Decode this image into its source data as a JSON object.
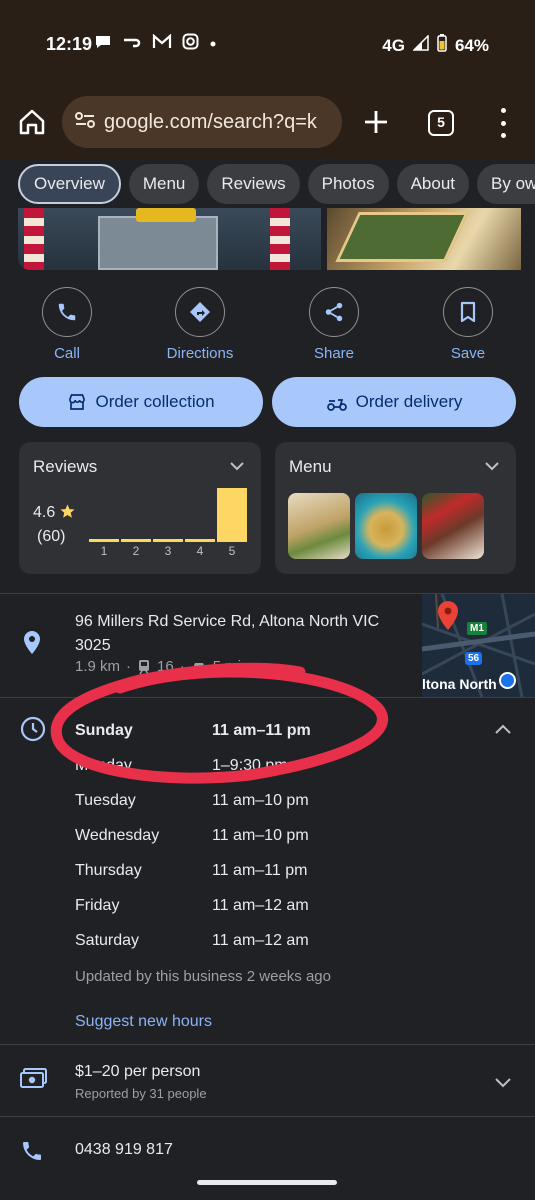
{
  "status": {
    "time": "12:19",
    "network": "4G",
    "battery": "64%"
  },
  "browser": {
    "url": "google.com/search?q=k",
    "tab_count": "5"
  },
  "nav": {
    "tabs": [
      {
        "label": "Overview"
      },
      {
        "label": "Menu"
      },
      {
        "label": "Reviews"
      },
      {
        "label": "Photos"
      },
      {
        "label": "About"
      },
      {
        "label": "By own"
      }
    ]
  },
  "actions": {
    "call": "Call",
    "directions": "Directions",
    "share": "Share",
    "save": "Save"
  },
  "order": {
    "collection": "Order collection",
    "delivery": "Order delivery"
  },
  "reviews_card": {
    "title": "Reviews",
    "rating": "4.6",
    "count": "(60)",
    "distribution": [
      {
        "star": "1",
        "fraction": 0.06
      },
      {
        "star": "2",
        "fraction": 0.06
      },
      {
        "star": "3",
        "fraction": 0.05
      },
      {
        "star": "4",
        "fraction": 0.04
      },
      {
        "star": "5",
        "fraction": 1.0
      }
    ]
  },
  "menu_card": {
    "title": "Menu"
  },
  "address": {
    "line": "96 Millers Rd Service Rd, Altona North VIC 3025",
    "distance": "1.9 km",
    "transit": "16",
    "drive": "5 mins",
    "map_label": "ltona North",
    "map_badge_1": "M1",
    "map_badge_2": "56"
  },
  "hours": {
    "days": [
      {
        "day": "Sunday",
        "time": "11 am–11 pm"
      },
      {
        "day": "Monday",
        "time": "1–9:30 pm"
      },
      {
        "day": "Tuesday",
        "time": "11 am–10 pm"
      },
      {
        "day": "Wednesday",
        "time": "11 am–10 pm"
      },
      {
        "day": "Thursday",
        "time": "11 am–11 pm"
      },
      {
        "day": "Friday",
        "time": "11 am–12 am"
      },
      {
        "day": "Saturday",
        "time": "11 am–12 am"
      }
    ],
    "updated": "Updated by this business 2 weeks ago",
    "suggest": "Suggest new hours"
  },
  "price": {
    "range": "$1–20 per person",
    "reported": "Reported by 31 people"
  },
  "phone": {
    "number": "0438 919 817"
  },
  "colors": {
    "accent": "#8ab4f8",
    "button_bg": "#a8c7fa",
    "star": "#fdd663",
    "annotation": "#e8304a"
  }
}
